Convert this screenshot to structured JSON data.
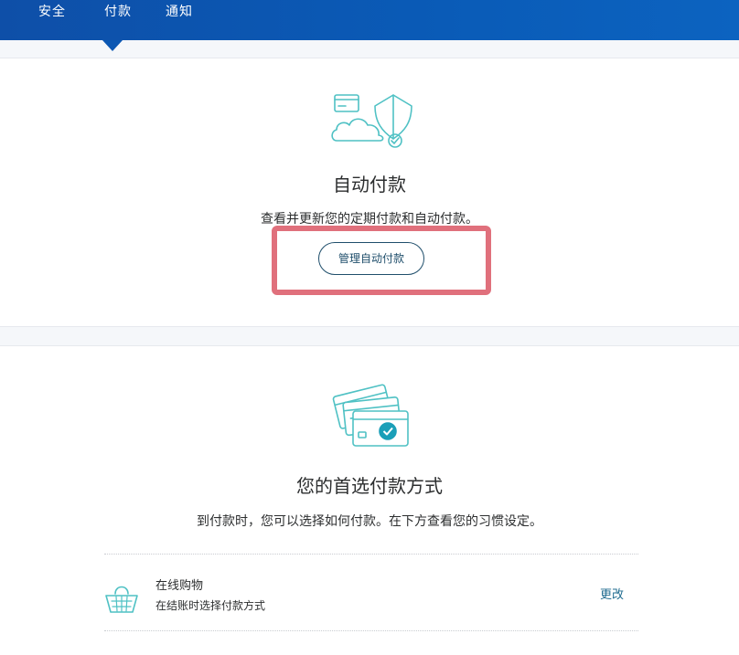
{
  "nav": {
    "tabs": [
      {
        "label": "安全"
      },
      {
        "label": "付款"
      },
      {
        "label": "通知"
      }
    ],
    "active_tab": "付款"
  },
  "auto_payments": {
    "icon": "cloud-shield-card-icon",
    "title": "自动付款",
    "description": "查看并更新您的定期付款和自动付款。",
    "button_label": "管理自动付款",
    "highlight_color": "#e0707c"
  },
  "preferred_payment": {
    "icon": "credit-cards-check-icon",
    "title": "您的首选付款方式",
    "description": "到付款时，您可以选择如何付款。在下方查看您的习惯设定。",
    "rows": [
      {
        "icon": "shopping-basket-icon",
        "title": "在线购物",
        "subtitle": "在结账时选择付款方式",
        "action": "更改"
      }
    ]
  },
  "colors": {
    "nav_blue": "#0a5bb7",
    "illustration_teal": "#4fc1c4",
    "link": "#1f6b8f"
  }
}
